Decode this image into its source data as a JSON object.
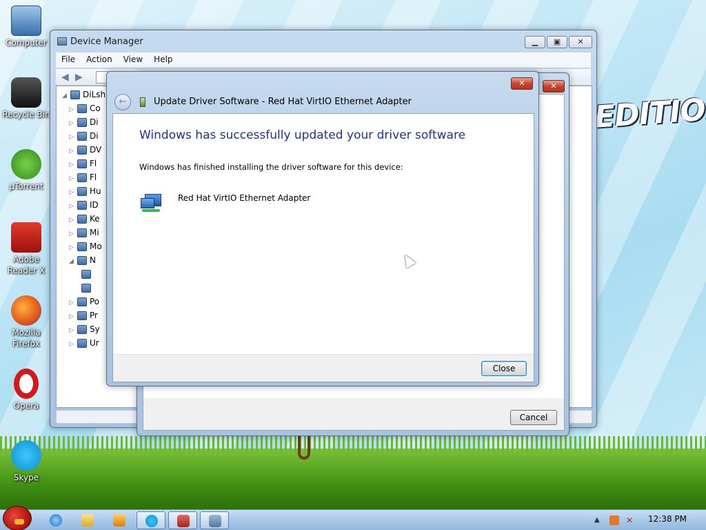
{
  "desktop": {
    "icons": [
      {
        "label": "Computer"
      },
      {
        "label": "Recycle Bin"
      },
      {
        "label": "µTorrent"
      },
      {
        "label": "Adobe Reader X"
      },
      {
        "label": "Mozilla Firefox"
      },
      {
        "label": "Opera"
      },
      {
        "label": "Skype"
      }
    ],
    "wallpaper_text": "EDITION"
  },
  "device_manager": {
    "title": "Device Manager",
    "menu": [
      "File",
      "Action",
      "View",
      "Help"
    ],
    "tree": {
      "root": "DiLsh",
      "items": [
        "Co",
        "Di",
        "Di",
        "DV",
        "Fl",
        "Fl",
        "Hu",
        "ID",
        "Ke",
        "Mi",
        "Mo",
        "N",
        "",
        "",
        "Po",
        "Pr",
        "Sy",
        "Ur"
      ]
    }
  },
  "wizard_background": {
    "cancel_label": "Cancel"
  },
  "dialog": {
    "title": "Update Driver Software - Red Hat VirtIO Ethernet Adapter",
    "heading": "Windows has successfully updated your driver software",
    "message": "Windows has finished installing the driver software for this device:",
    "device_name": "Red Hat VirtIO Ethernet Adapter",
    "close_label": "Close"
  },
  "taskbar": {
    "time": "12:38 PM"
  },
  "colors": {
    "heading_blue": "#1e3287",
    "close_red": "#c7452c"
  }
}
